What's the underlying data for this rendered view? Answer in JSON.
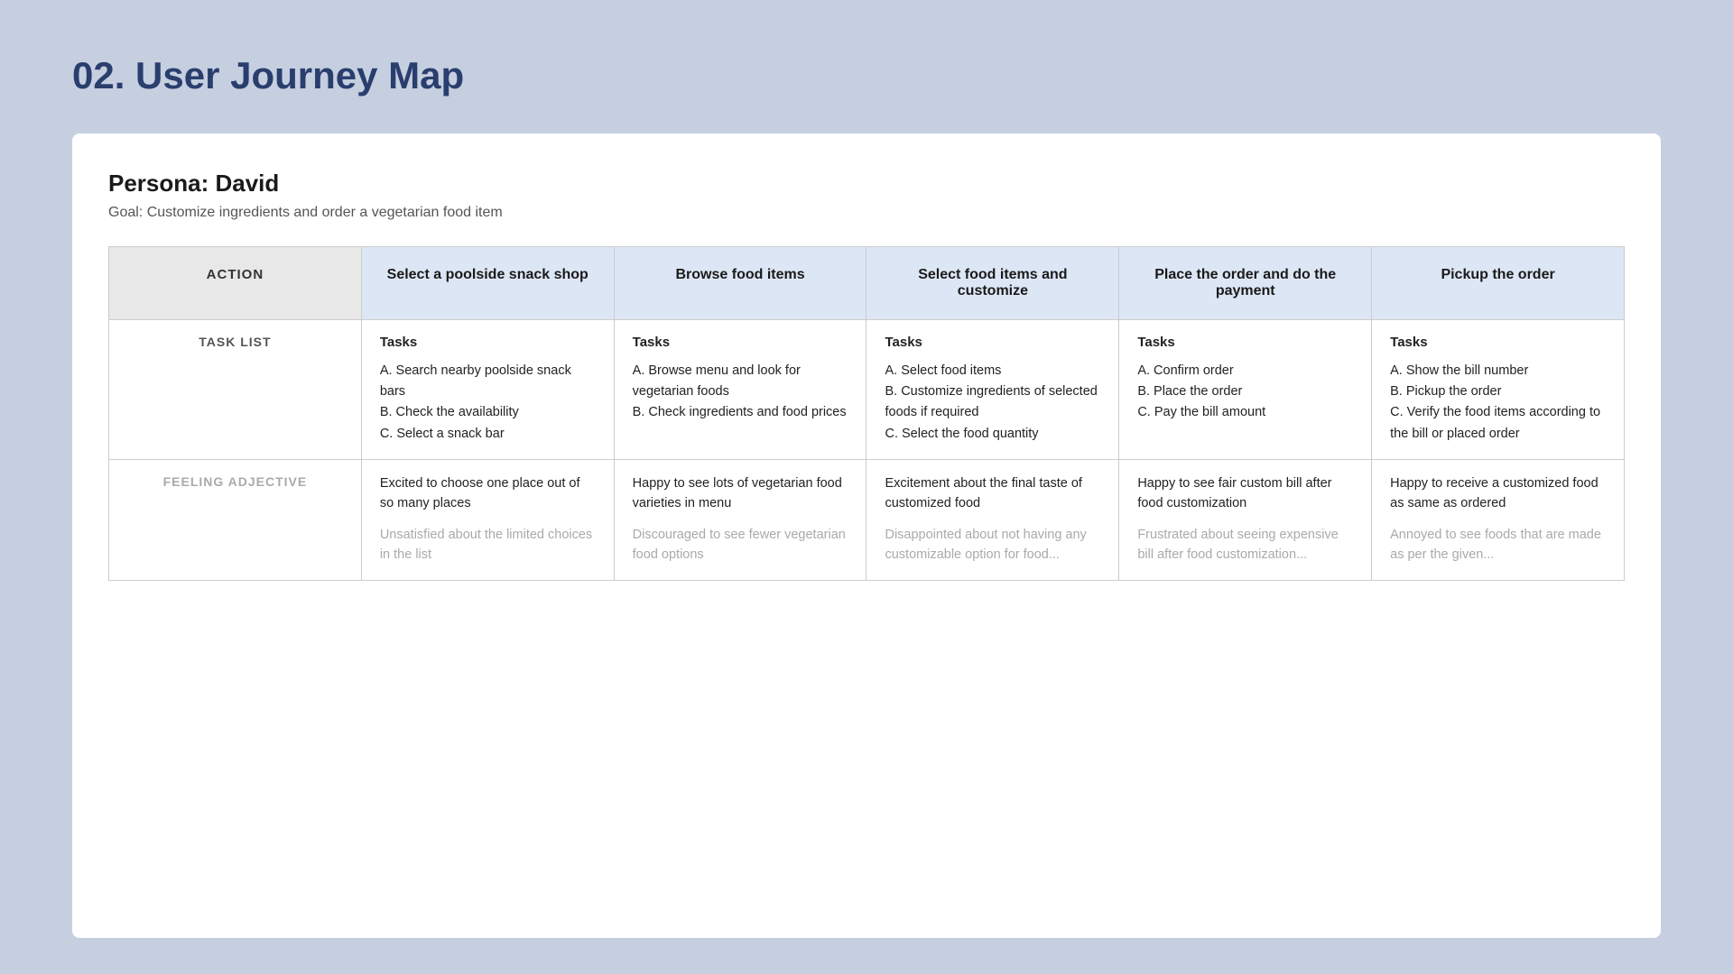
{
  "page": {
    "title": "02. User Journey Map"
  },
  "persona": {
    "name": "Persona: David",
    "goal": "Goal: Customize ingredients and order a vegetarian food item"
  },
  "table": {
    "header": {
      "col0": "ACTION",
      "col1": "Select a poolside snack shop",
      "col2": "Browse food items",
      "col3": "Select food items and customize",
      "col4": "Place the order and do the payment",
      "col5": "Pickup the order"
    },
    "taskRow": {
      "rowLabel": "TASK LIST",
      "col1": {
        "label": "Tasks",
        "items": "A. Search nearby poolside snack bars\nB. Check the availability\nC. Select a snack bar"
      },
      "col2": {
        "label": "Tasks",
        "items": "A. Browse menu and look for vegetarian foods\nB. Check ingredients and food prices"
      },
      "col3": {
        "label": "Tasks",
        "items": "A. Select food items\nB. Customize ingredients of selected foods if required\nC. Select the food quantity"
      },
      "col4": {
        "label": "Tasks",
        "items": "A. Confirm order\nB. Place the order\nC. Pay the bill amount"
      },
      "col5": {
        "label": "Tasks",
        "items": "A. Show the bill number\nB. Pickup the order\nC. Verify the food items according to the bill or placed order"
      }
    },
    "feelingRow": {
      "rowLabel": "FEELING ADJECTIVE",
      "col1": {
        "positive": "Excited to choose one place out of so many places",
        "negative": "Unsatisfied about the limited choices in the list"
      },
      "col2": {
        "positive": "Happy to see lots of vegetarian food varieties in menu",
        "negative": "Discouraged to see fewer vegetarian food options"
      },
      "col3": {
        "positive": "Excitement about the final taste of customized food",
        "negative": "Disappointed about not having any customizable option for food..."
      },
      "col4": {
        "positive": "Happy to see fair custom bill after food customization",
        "negative": "Frustrated about seeing expensive bill after food customization..."
      },
      "col5": {
        "positive": "Happy to receive a customized food as same as ordered",
        "negative": "Annoyed to see foods that are made as per the given..."
      }
    }
  }
}
